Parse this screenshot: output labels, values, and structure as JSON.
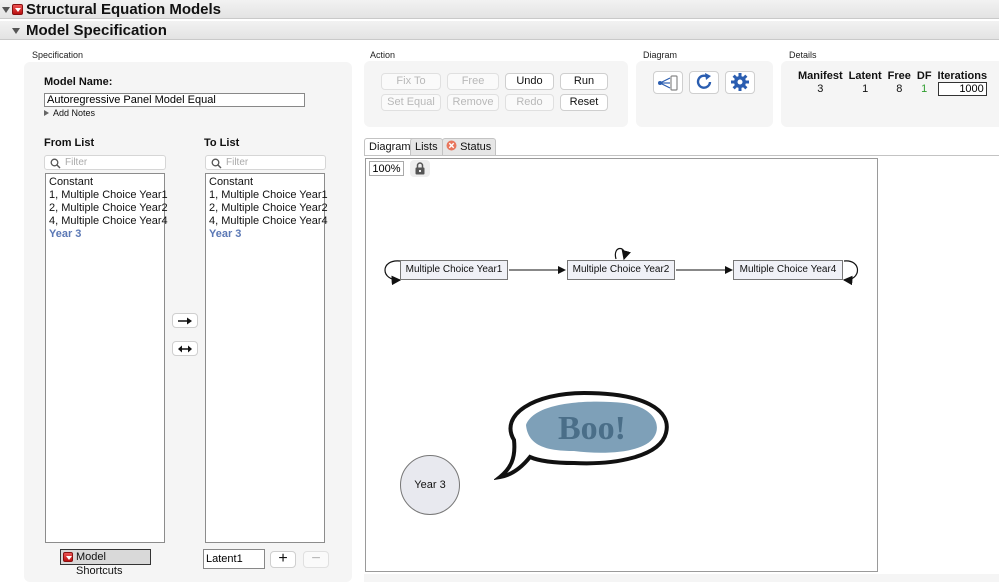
{
  "window": {
    "title": "Structural Equation Models",
    "section_title": "Model Specification"
  },
  "specification": {
    "section_label": "Specification",
    "model_name_label": "Model Name:",
    "model_name_value": "Autoregressive Panel Model Equal",
    "add_notes": "Add Notes",
    "from_list_label": "From List",
    "to_list_label": "To List",
    "filter_placeholder": "Filter",
    "from_list_items": [
      "Constant",
      "1, Multiple Choice Year1",
      "2, Multiple Choice Year2",
      "4, Multiple Choice Year4",
      "Year 3"
    ],
    "to_list_items": [
      "Constant",
      "1, Multiple Choice Year1",
      "2, Multiple Choice Year2",
      "4, Multiple Choice Year4",
      "Year 3"
    ],
    "model_shortcuts": "Model Shortcuts",
    "latent_name_value": "Latent1",
    "add_icon": "plus-icon",
    "remove_icon": "minus-icon",
    "one_way_arrow_icon": "right-arrow-icon",
    "two_way_arrow_icon": "double-arrow-icon"
  },
  "action": {
    "section_label": "Action",
    "fix_to": "Fix To",
    "free": "Free",
    "undo": "Undo",
    "run": "Run",
    "set_equal": "Set Equal",
    "remove": "Remove",
    "redo": "Redo",
    "reset": "Reset"
  },
  "diagram_tools": {
    "section_label": "Diagram",
    "icons": [
      "layout-icon",
      "refresh-icon",
      "gear-icon"
    ]
  },
  "details": {
    "section_label": "Details",
    "headers": [
      "Manifest",
      "Latent",
      "Free",
      "DF",
      "Iterations"
    ],
    "values": [
      "3",
      "1",
      "8",
      "1"
    ],
    "iterations_value": "1000",
    "df_color": "#2e9e2e"
  },
  "tabs": {
    "diagram": "Diagram",
    "lists": "Lists",
    "status": "Status"
  },
  "canvas": {
    "zoom": "100%",
    "nodes": {
      "year1": "Multiple Choice Year1",
      "year2": "Multiple Choice Year2",
      "year4": "Multiple Choice Year4",
      "latent": "Year 3"
    },
    "sticker_text": "Boo!"
  }
}
